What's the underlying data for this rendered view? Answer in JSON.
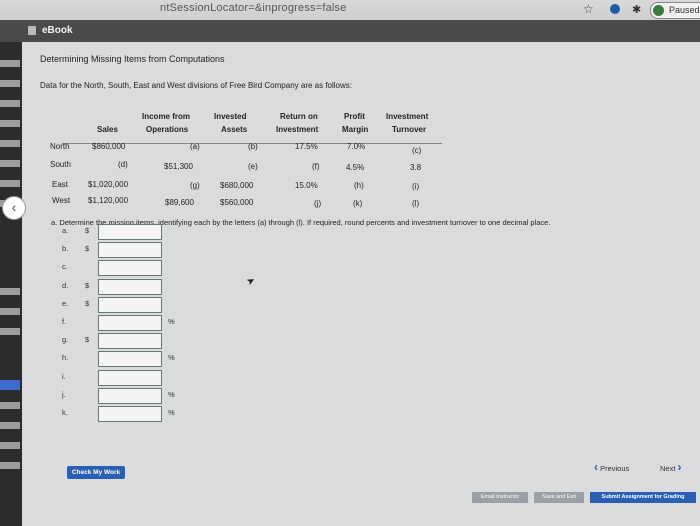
{
  "browser": {
    "url_fragment": "ntSessionLocator=&inprogress=false",
    "paused": "Paused"
  },
  "ebook": {
    "label": "eBook"
  },
  "problem": {
    "title": "Determining Missing Items from Computations",
    "intro": "Data for the North, South, East and West divisions of Free Bird Company are as follows:",
    "headers": {
      "sales": "Sales",
      "income_l1": "Income from",
      "income_l2": "Operations",
      "assets_l1": "Invested",
      "assets_l2": "Assets",
      "roi_l1": "Return on",
      "roi_l2": "Investment",
      "margin_l1": "Profit",
      "margin_l2": "Margin",
      "turnover_l1": "Investment",
      "turnover_l2": "Turnover"
    },
    "rows": [
      {
        "division": "North",
        "sales": "$860,000",
        "income": "(a)",
        "assets": "(b)",
        "roi": "17.5%",
        "margin": "7.0%",
        "turnover": "(c)"
      },
      {
        "division": "South",
        "sales": "(d)",
        "income": "$51,300",
        "assets": "(e)",
        "roi": "(f)",
        "margin": "4.5%",
        "turnover": "3.8"
      },
      {
        "division": "East",
        "sales": "$1,020,000",
        "income": "(g)",
        "assets": "$680,000",
        "roi": "15.0%",
        "margin": "(h)",
        "turnover": "(i)"
      },
      {
        "division": "West",
        "sales": "$1,120,000",
        "income": "$89,600",
        "assets": "$560,000",
        "roi": "(j)",
        "margin": "(k)",
        "turnover": "(l)"
      }
    ],
    "question": "a. Determine the missing items, identifying each by the letters (a) through (l). If required, round percents and investment turnover to one decimal place."
  },
  "answers": [
    {
      "label": "a.",
      "prefix": "$",
      "suffix": "",
      "value": ""
    },
    {
      "label": "b.",
      "prefix": "$",
      "suffix": "",
      "value": ""
    },
    {
      "label": "c.",
      "prefix": "",
      "suffix": "",
      "value": ""
    },
    {
      "label": "d.",
      "prefix": "$",
      "suffix": "",
      "value": ""
    },
    {
      "label": "e.",
      "prefix": "$",
      "suffix": "",
      "value": ""
    },
    {
      "label": "f.",
      "prefix": "",
      "suffix": "%",
      "value": ""
    },
    {
      "label": "g.",
      "prefix": "$",
      "suffix": "",
      "value": ""
    },
    {
      "label": "h.",
      "prefix": "",
      "suffix": "%",
      "value": ""
    },
    {
      "label": "i.",
      "prefix": "",
      "suffix": "",
      "value": ""
    },
    {
      "label": "j.",
      "prefix": "",
      "suffix": "%",
      "value": ""
    },
    {
      "label": "k.",
      "prefix": "",
      "suffix": "%",
      "value": ""
    }
  ],
  "buttons": {
    "check": "Check My Work",
    "previous": "Previous",
    "next": "Next",
    "email": "Email Instructor",
    "save": "Save and Exit",
    "submit": "Submit Assignment for Grading"
  },
  "colors": {
    "accent": "#2a5fb6",
    "page_bg": "#d9dbdd"
  }
}
